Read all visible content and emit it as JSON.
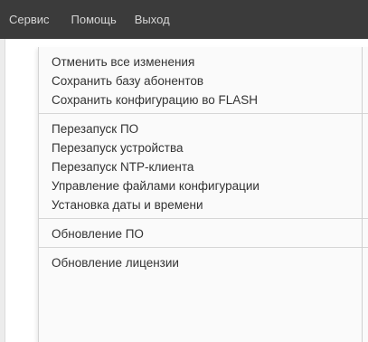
{
  "menubar": {
    "items": [
      {
        "label": "Сервис"
      },
      {
        "label": "Помощь"
      },
      {
        "label": "Выход"
      }
    ]
  },
  "dropdown": {
    "groups": [
      {
        "items": [
          {
            "label": "Отменить все изменения"
          },
          {
            "label": "Сохранить базу абонентов"
          },
          {
            "label": "Сохранить конфигурацию во FLASH"
          }
        ]
      },
      {
        "items": [
          {
            "label": "Перезапуск ПО"
          },
          {
            "label": "Перезапуск устройства"
          },
          {
            "label": "Перезапуск NTP-клиента"
          },
          {
            "label": "Управление файлами конфигурации"
          },
          {
            "label": "Установка даты и времени"
          }
        ]
      },
      {
        "items": [
          {
            "label": "Обновление ПО"
          }
        ]
      },
      {
        "items": [
          {
            "label": "Обновление лицензии"
          }
        ]
      }
    ]
  },
  "colors": {
    "menubar_bg": "#3b3b3b",
    "menubar_text": "#d6d6d6",
    "dropdown_bg": "#fafafa",
    "item_text": "#333333",
    "separator": "#d6d6d6"
  }
}
